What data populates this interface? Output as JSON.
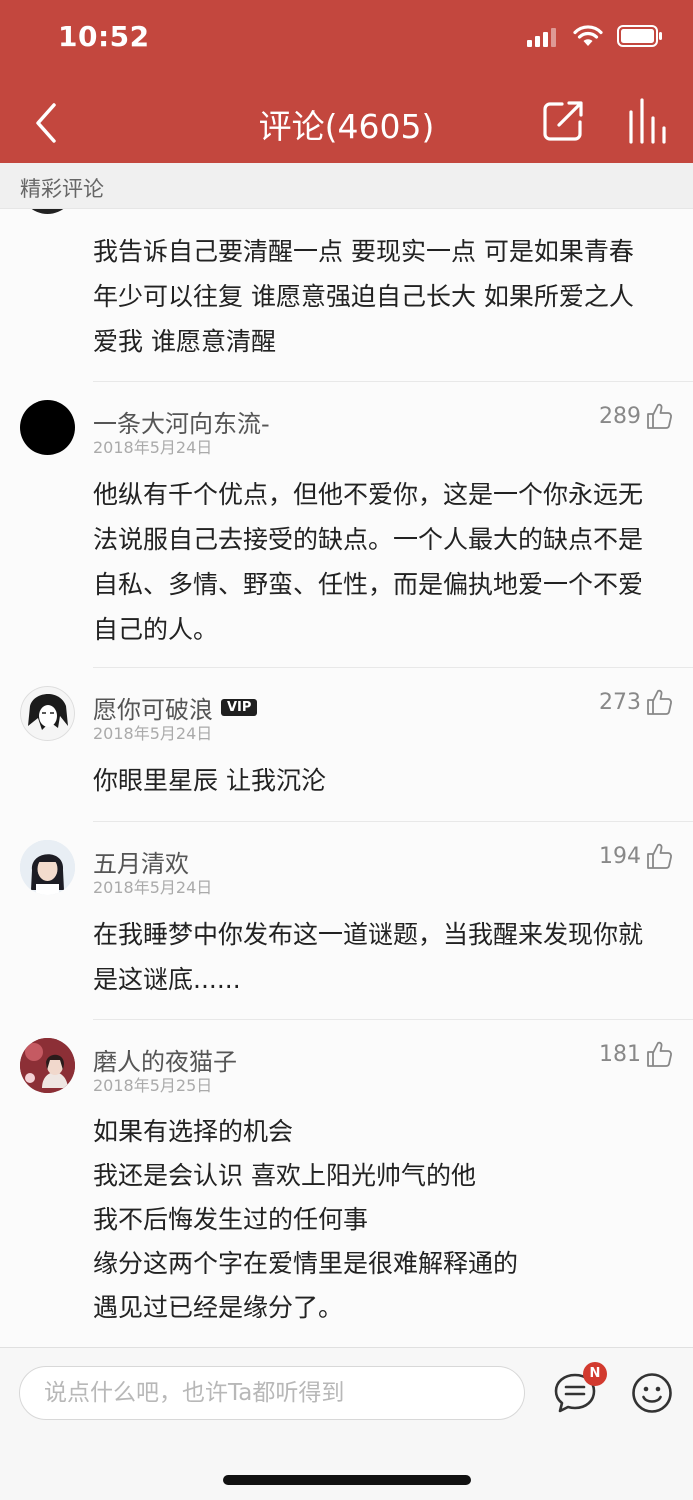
{
  "status": {
    "time": "10:52"
  },
  "nav": {
    "title": "评论(4605)"
  },
  "section": {
    "label": "精彩评论"
  },
  "partial_comment": {
    "lines": [
      "我告诉自己要清醒一点 要现实一点 可是如果青春",
      "年少可以往复 谁愿意强迫自己长大 如果所爱之人",
      "爱我 谁愿意清醒"
    ]
  },
  "comments": [
    {
      "username": "一条大河向东流-",
      "date": "2018年5月24日",
      "likes": "289",
      "lines": [
        "他纵有千个优点，但他不爱你，这是一个你永远无",
        "法说服自己去接受的缺点。一个人最大的缺点不是",
        "自私、多情、野蛮、任性，而是偏执地爱一个不爱",
        "自己的人。"
      ]
    },
    {
      "username": "愿你可破浪",
      "badge": "VIP",
      "date": "2018年5月24日",
      "likes": "273",
      "lines": [
        "你眼里星辰  让我沉沦"
      ]
    },
    {
      "username": "五月清欢",
      "date": "2018年5月24日",
      "likes": "194",
      "lines": [
        "在我睡梦中你发布这一道谜题，当我醒来发现你就",
        "是这谜底......"
      ]
    },
    {
      "username": "磨人的夜猫子",
      "date": "2018年5月25日",
      "likes": "181",
      "lines": [
        "如果有选择的机会",
        "我还是会认识 喜欢上阳光帅气的他",
        "我不后悔发生过的任何事",
        "缘分这两个字在爱情里是很难解释通的",
        "遇见过已经是缘分了。"
      ]
    }
  ],
  "input": {
    "placeholder": "说点什么吧，也许Ta都听得到"
  },
  "notification_badge": "N",
  "colors": {
    "header": "#c3473e",
    "badge": "#d23a2f"
  }
}
